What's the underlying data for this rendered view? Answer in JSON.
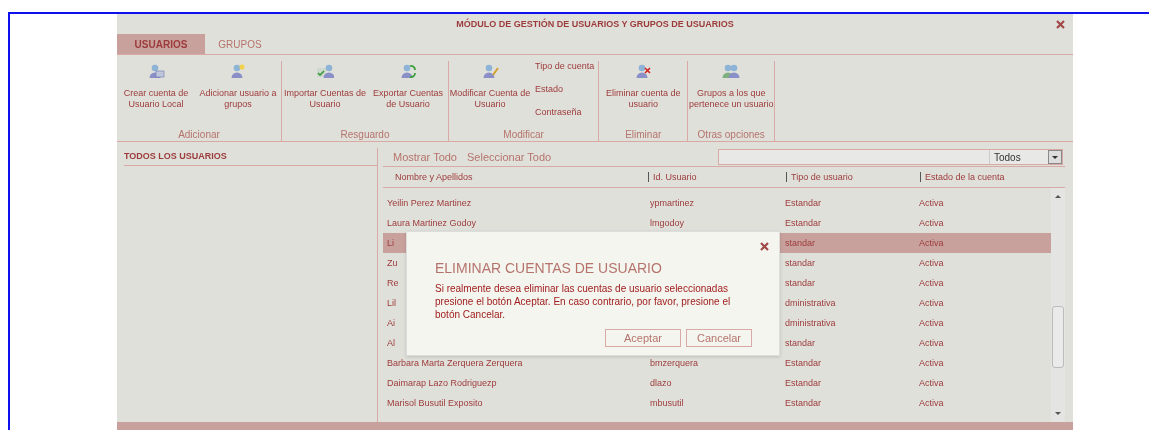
{
  "module": {
    "title": "MÓDULO DE GESTIÓN DE USUARIOS Y GRUPOS DE USUARIOS"
  },
  "tabs": [
    {
      "label": "USUARIOS",
      "selected": true
    },
    {
      "label": "GRUPOS",
      "selected": false
    }
  ],
  "toolbar": [
    {
      "group": "Adicionar",
      "buttons": [
        "Crear cuenta de Usuario Local",
        "Adicionar usuario a grupos"
      ]
    },
    {
      "group": "Resguardo",
      "buttons": [
        "Importar Cuentas de Usuario",
        "Exportar Cuentas de Usuario"
      ]
    },
    {
      "group": "Modificar",
      "buttons": [
        "Modificar Cuenta de Usuario"
      ],
      "links": [
        "Tipo de cuenta",
        "Estado",
        "Contraseña"
      ]
    },
    {
      "group": "Eliminar",
      "buttons": [
        "Eliminar cuenta de usuario"
      ]
    },
    {
      "group": "Otras opciones",
      "buttons": [
        "Grupos a los que pertenece un usuario"
      ]
    }
  ],
  "left_pane": {
    "title": "TODOS LOS USUARIOS"
  },
  "list_actions": [
    "Mostrar Todo",
    "Seleccionar Todo"
  ],
  "filter": {
    "select": "Todos"
  },
  "table": {
    "columns": [
      "Nombre y Apellidos",
      "Id. Usuario",
      "Tipo de usuario",
      "Estado de la cuenta"
    ],
    "rows": [
      {
        "name": "Yeilin Perez Martinez",
        "id": "ypmartinez",
        "type": "Estandar",
        "status": "Activa",
        "selected": false
      },
      {
        "name": "Laura Martinez Godoy",
        "id": "lmgodoy",
        "type": "Estandar",
        "status": "Activa",
        "selected": false
      },
      {
        "name": "Li",
        "type": "standar",
        "status": "Activa",
        "selected": true
      },
      {
        "name": "Zu",
        "type": "standar",
        "status": "Activa",
        "selected": false
      },
      {
        "name": "Re",
        "type": "standar",
        "status": "Activa",
        "selected": false
      },
      {
        "name": "Lil",
        "type": "dministrativa",
        "status": "Activa",
        "selected": false
      },
      {
        "name": "Ai",
        "type": "dministrativa",
        "status": "Activa",
        "selected": false
      },
      {
        "name": "Al",
        "type": "standar",
        "status": "Activa",
        "selected": false
      },
      {
        "name": "Barbara Marta Zerquera Zerquera",
        "id": "bmzerquera",
        "type": "Estandar",
        "status": "Activa",
        "selected": false
      },
      {
        "name": "Daimarap Lazo Rodriguezp",
        "id": "dlazo",
        "type": "Estandar",
        "status": "Activa",
        "selected": false
      },
      {
        "name": "Marisol Busutil Exposito",
        "id": "mbusutil",
        "type": "Estandar",
        "status": "Activa",
        "selected": false
      }
    ]
  },
  "dialog": {
    "title": "ELIMINAR CUENTAS DE USUARIO",
    "message": "Si realmente desea eliminar las cuentas de usuario seleccionadas presione el botón Aceptar. En caso contrario, por favor, presione el botón Cancelar.",
    "buttons": [
      "Aceptar",
      "Cancelar"
    ]
  }
}
